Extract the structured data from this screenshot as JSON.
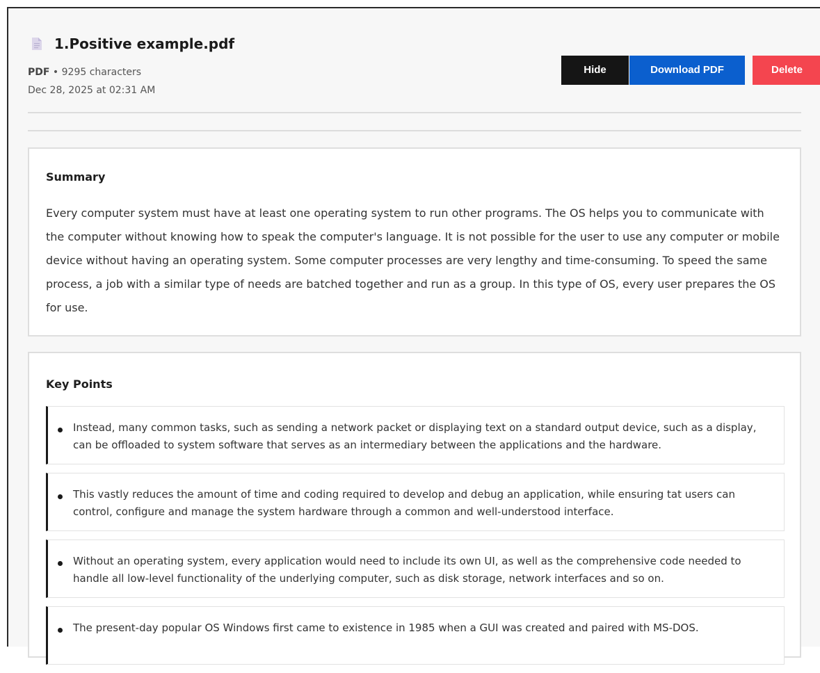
{
  "document": {
    "file_name": "1.Positive example.pdf",
    "file_type": "PDF",
    "separator": "•",
    "characters": "9295 characters",
    "date": "Dec 28, 2025 at 02:31 AM"
  },
  "actions": {
    "hide_label": "Hide",
    "download_label": "Download PDF",
    "delete_label": "Delete"
  },
  "summary": {
    "heading": "Summary",
    "text": "Every computer system must have at least one operating system to run other programs. The OS helps you to communicate with the computer without knowing how to speak the computer's language. It is not possible for the user to use any computer or mobile device without having an operating system. Some computer processes are very lengthy and time-consuming. To speed the same process, a job with a similar type of needs are batched together and run as a group. In this type of OS, every user prepares the OS for use."
  },
  "key_points": {
    "heading": "Key Points",
    "items": [
      "Instead, many common tasks, such as sending a network packet or displaying text on a standard output device, such as a display, can be offloaded to system software that serves as an intermediary between the applications and the hardware.",
      "This vastly reduces the amount of time and coding required to develop and debug an application, while ensuring tat users can control, configure and manage the system hardware through a common and well-understood interface.",
      "Without an operating system, every application would need to include its own UI, as well as the comprehensive code needed to handle all low-level functionality of the underlying computer, such as disk storage, network interfaces and so on.",
      "The present-day popular OS Windows first came to existence in 1985 when a GUI was created and paired with MS-DOS."
    ]
  },
  "icons": {
    "file": "document-icon",
    "bullet": "bullet-icon"
  },
  "colors": {
    "hide_button": "#151515",
    "download_button": "#0b5fce",
    "delete_button": "#f4454f",
    "key_point_accent": "#1a1a1a"
  }
}
